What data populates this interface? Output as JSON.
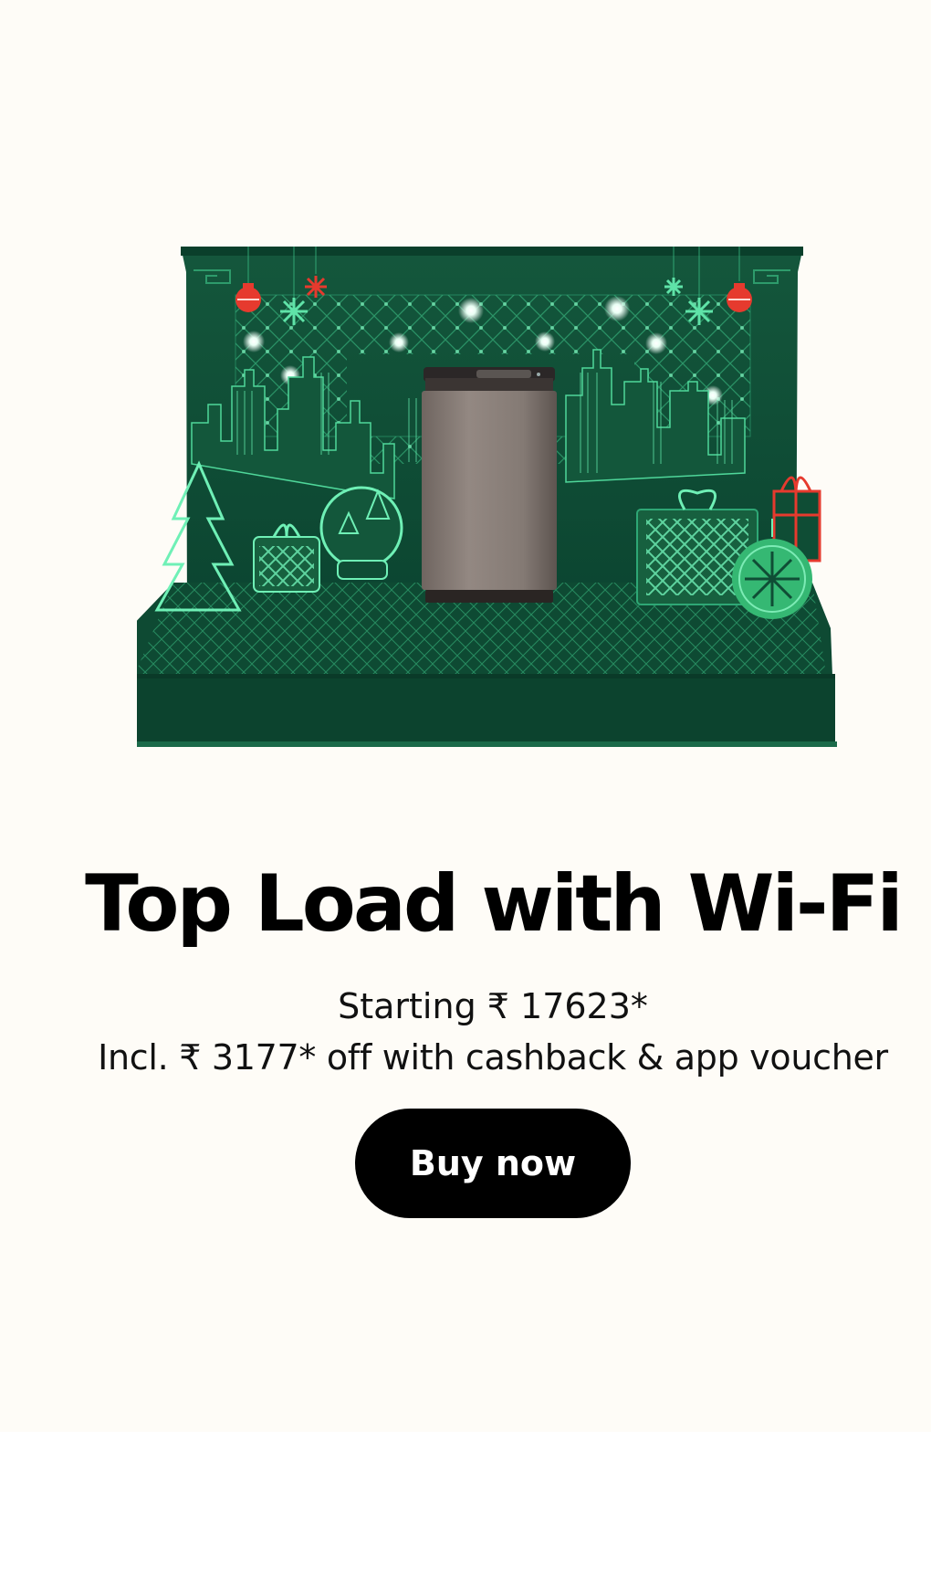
{
  "banner": {
    "title": "Top Load with Wi-Fi",
    "starting_text": "Starting ₹ 17623*",
    "offer_text": "Incl. ₹ 3177* off with cashback & app voucher",
    "cta_label": "Buy now"
  },
  "colors": {
    "background": "#fefcf7",
    "box_green": "#0f4d35",
    "glow_green": "#5fe3a8",
    "ornament_red": "#e63a2e",
    "button": "#000000",
    "button_text": "#ffffff"
  }
}
